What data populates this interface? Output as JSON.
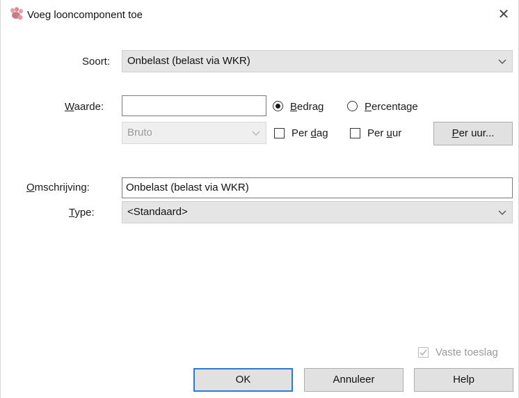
{
  "window": {
    "title": "Voeg looncomponent toe",
    "app_icon": "paws-app-icon",
    "close_icon": "close-icon",
    "close_glyph": "✕"
  },
  "form": {
    "soort": {
      "label": "Soort:",
      "value": "Onbelast (belast via WKR)"
    },
    "waarde": {
      "label_underlined": "W",
      "label_rest": "aarde:",
      "value": "",
      "mode_options": [
        {
          "underlined": "B",
          "rest": "edrag",
          "selected": true
        },
        {
          "underlined": "P",
          "rest": "ercentage",
          "selected": false
        }
      ],
      "basis": {
        "value": "Bruto",
        "enabled": false
      },
      "per_dag": {
        "prefix": "Per ",
        "underlined": "d",
        "rest": "ag",
        "checked": false
      },
      "per_uur": {
        "prefix": "Per ",
        "underlined": "u",
        "rest": "ur",
        "checked": false
      },
      "per_uur_button": {
        "underlined": "P",
        "rest": "er uur..."
      }
    },
    "omschrijving": {
      "label_underlined": "O",
      "label_rest": "mschrijving:",
      "value": "Onbelast (belast via WKR)"
    },
    "type": {
      "label_underlined": "T",
      "label_rest": "ype:",
      "value": "<Standaard>"
    },
    "vaste_toeslag": {
      "label": "Vaste toeslag",
      "checked": true,
      "enabled": false
    }
  },
  "buttons": {
    "ok": "OK",
    "cancel": "Annuleer",
    "help": "Help"
  },
  "colors": {
    "default_button_border": "#2b7bd6",
    "combo_bg": "#e5e5e5",
    "disabled_text": "#9a9a9a"
  }
}
